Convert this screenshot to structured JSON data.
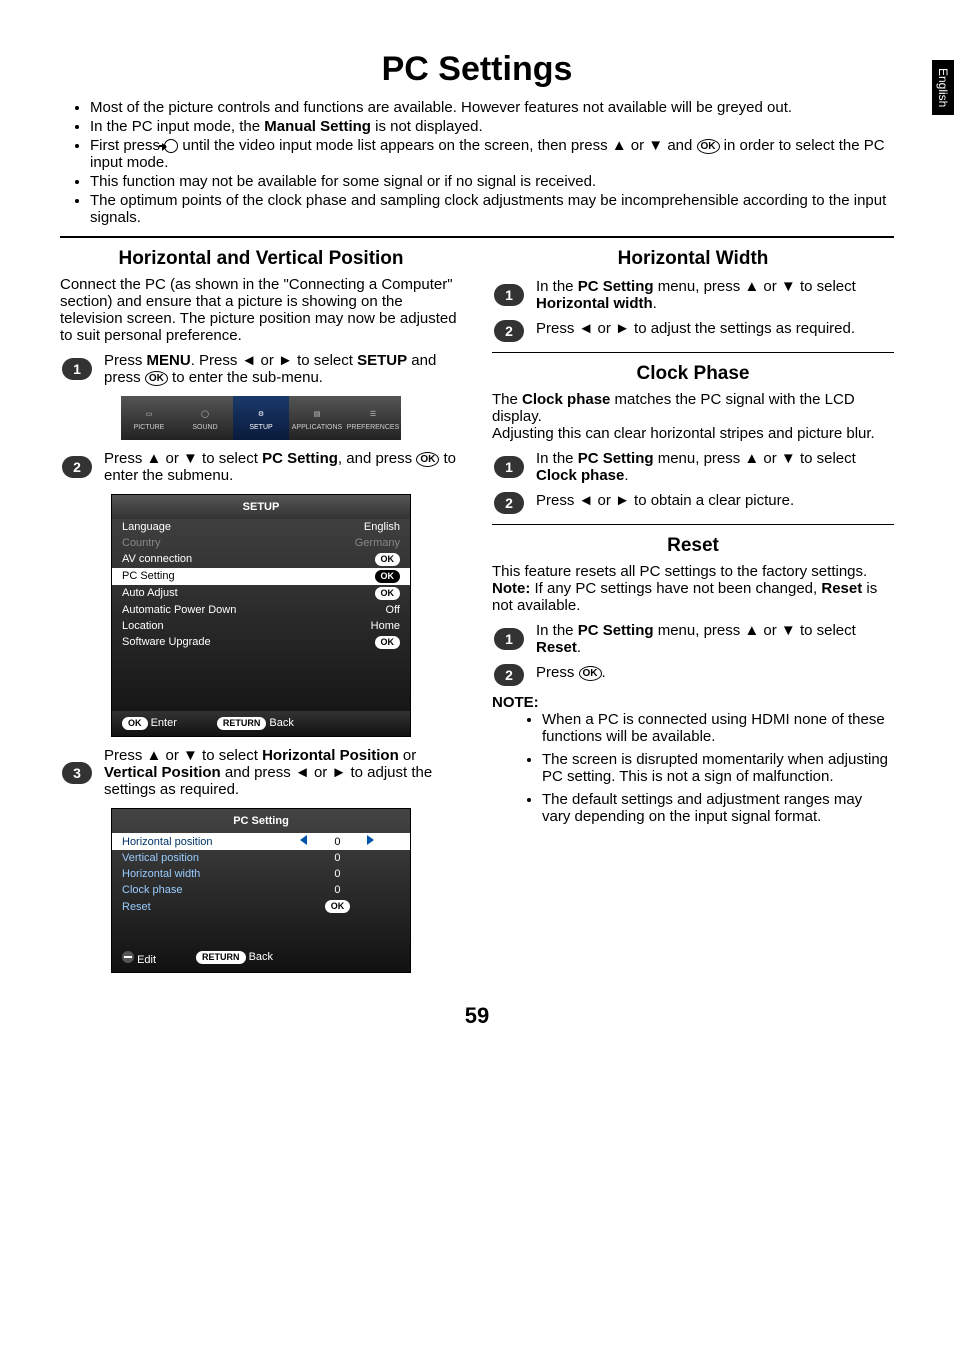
{
  "side_tab": "English",
  "page_title": "PC Settings",
  "intro_bullets": [
    "Most of the picture controls and functions are available. However features not available will be greyed out.",
    "In the PC input mode, the <b>Manual Setting</b> is not displayed.",
    "First press {INPUT} until the video input mode list appears on the screen, then press ▲ or ▼ and {OK} in order to select the PC input mode.",
    "This function may not be available for some signal or if no signal is received.",
    "The optimum points of the clock phase and sampling clock adjustments may be incomprehensible according to the input signals."
  ],
  "left": {
    "section1_title": "Horizontal and Vertical Position",
    "section1_intro": "Connect the PC (as shown in the \"Connecting a Computer\" section) and ensure that a picture is showing on the television screen. The picture position may now be adjusted to suit personal preference.",
    "step1": "Press <b>MENU</b>. Press ◄ or ► to select <b>SETUP</b> and press {OK} to enter the sub-menu.",
    "step2": "Press ▲ or ▼ to select <b>PC Setting</b>, and press {OK} to enter the submenu.",
    "step3": "Press ▲ or ▼ to select <b>Horizontal Position</b> or <b>Vertical Position</b> and press ◄ or ► to adjust the settings as required.",
    "menubar": [
      "PICTURE",
      "SOUND",
      "SETUP",
      "APPLICATIONS",
      "PREFERENCES"
    ],
    "setup_osd": {
      "title": "SETUP",
      "rows": [
        {
          "label": "Language",
          "value": "English",
          "sel": false
        },
        {
          "label": "Country",
          "value": "Germany",
          "dim": true
        },
        {
          "label": "AV connection",
          "value": "OK",
          "pill": true
        },
        {
          "label": "PC Setting",
          "value": "OK",
          "pill": true,
          "sel": true
        },
        {
          "label": "Auto Adjust",
          "value": "OK",
          "pill": true
        },
        {
          "label": "Automatic Power Down",
          "value": "Off"
        },
        {
          "label": "Location",
          "value": "Home"
        },
        {
          "label": "Software Upgrade",
          "value": "OK",
          "pill": true
        }
      ],
      "foot_left_pill": "OK",
      "foot_left": "Enter",
      "foot_right_pill": "RETURN",
      "foot_right": "Back"
    },
    "pc_osd": {
      "title": "PC Setting",
      "rows": [
        {
          "label": "Horizontal position",
          "value": "0",
          "sel": true,
          "arrows": true
        },
        {
          "label": "Vertical position",
          "value": "0"
        },
        {
          "label": "Horizontal width",
          "value": "0"
        },
        {
          "label": "Clock phase",
          "value": "0"
        },
        {
          "label": "Reset",
          "value": "OK",
          "pill": true
        }
      ],
      "foot_left": "Edit",
      "foot_right_pill": "RETURN",
      "foot_right": "Back"
    }
  },
  "right": {
    "hw_title": "Horizontal Width",
    "hw_step1": "In the <b>PC Setting</b> menu, press ▲ or ▼ to select <b>Horizontal width</b>.",
    "hw_step2": "Press ◄ or ► to adjust the settings as required.",
    "cp_title": "Clock Phase",
    "cp_intro1": "The <b>Clock phase</b> matches the PC signal with the LCD display.",
    "cp_intro2": "Adjusting this can clear horizontal stripes and picture blur.",
    "cp_step1": "In the <b>PC Setting</b> menu, press ▲ or ▼ to select <b>Clock phase</b>.",
    "cp_step2": "Press ◄ or ► to obtain a clear picture.",
    "rs_title": "Reset",
    "rs_intro": "This feature resets all PC settings to the factory settings.",
    "rs_note": "<b>Note:</b> If any PC settings have not been changed, <b>Reset</b> is not available.",
    "rs_step1": "In the <b>PC Setting</b> menu, press ▲ or ▼ to select <b>Reset</b>.",
    "rs_step2": "Press {OK}.",
    "note_head": "NOTE:",
    "notes": [
      "When a PC is connected using HDMI none of these functions will be available.",
      "The screen is disrupted momentarily when adjusting PC setting. This is not a sign of malfunction.",
      "The default settings and adjustment ranges may vary depending on the input signal format."
    ]
  },
  "page_number": "59"
}
